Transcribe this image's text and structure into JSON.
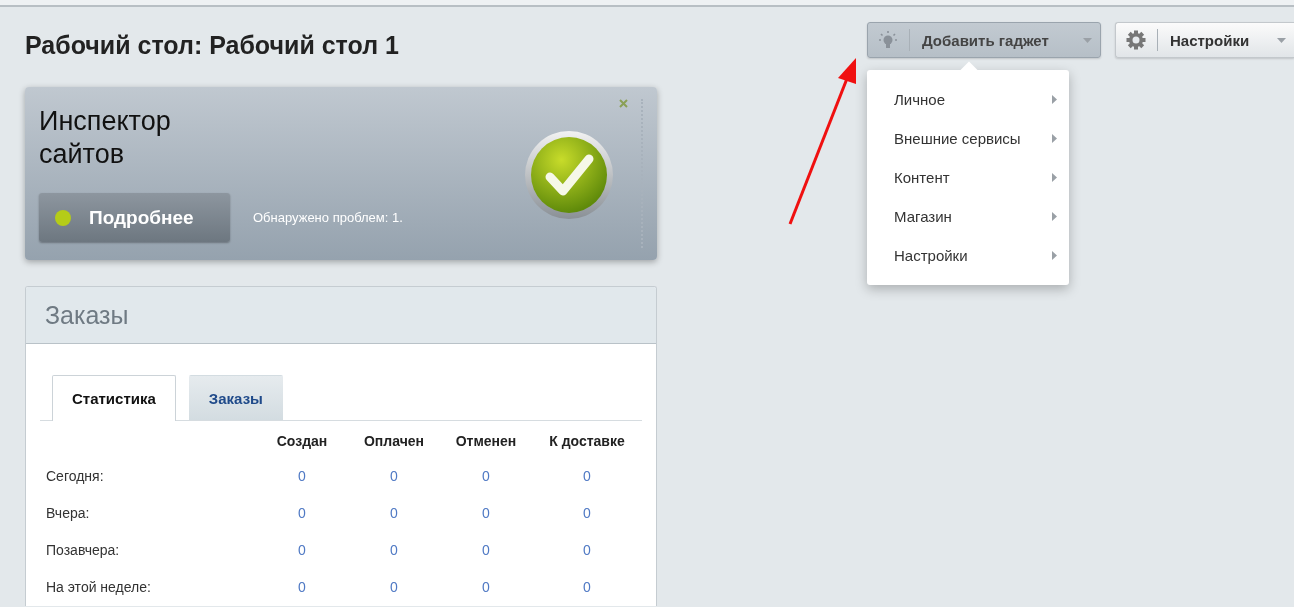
{
  "page_title": "Рабочий стол: Рабочий стол 1",
  "toolbar": [
    {
      "kind": "add",
      "label": "Добавить гаджет",
      "pressed": true
    },
    {
      "kind": "settings",
      "label": "Настройки",
      "pressed": false
    }
  ],
  "gadget_menu": [
    {
      "label": "Личное"
    },
    {
      "label": "Внешние сервисы"
    },
    {
      "label": "Контент"
    },
    {
      "label": "Магазин"
    },
    {
      "label": "Настройки"
    }
  ],
  "inspector": {
    "title": "Инспектор сайтов",
    "button": "Подробнее",
    "message": "Обнаружено проблем: 1."
  },
  "orders": {
    "title": "Заказы",
    "tabs": [
      {
        "label": "Статистика",
        "selected": true
      },
      {
        "label": "Заказы",
        "selected": false
      }
    ],
    "columns": [
      "Создан",
      "Оплачен",
      "Отменен",
      "К доставке"
    ],
    "rows": [
      {
        "label": "Сегодня:",
        "values": [
          "0",
          "0",
          "0",
          "0"
        ]
      },
      {
        "label": "Вчера:",
        "values": [
          "0",
          "0",
          "0",
          "0"
        ]
      },
      {
        "label": "Позавчера:",
        "values": [
          "0",
          "0",
          "0",
          "0"
        ]
      },
      {
        "label": "На этой неделе:",
        "values": [
          "0",
          "0",
          "0",
          "0"
        ]
      }
    ]
  }
}
